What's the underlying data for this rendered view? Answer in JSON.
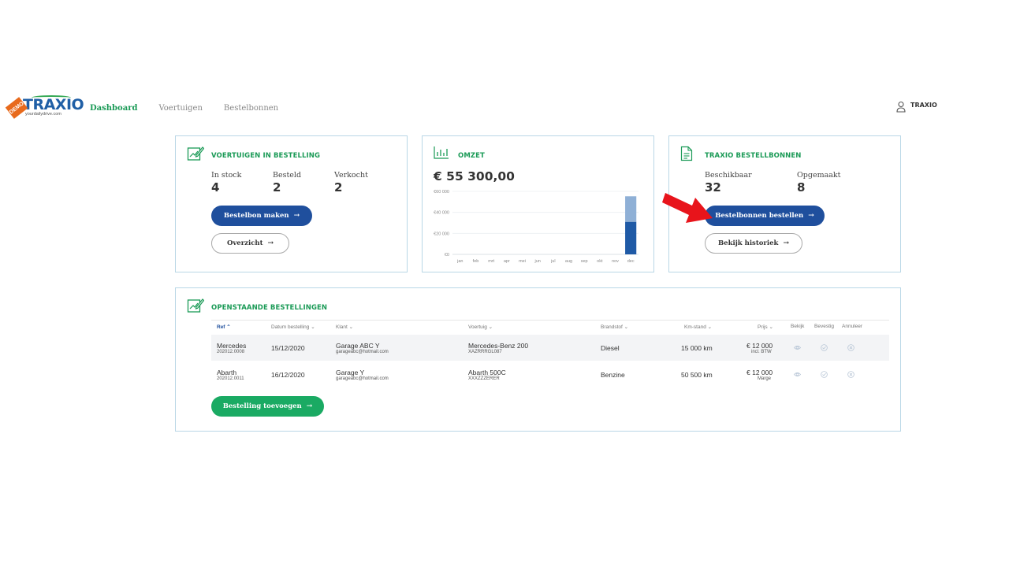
{
  "header": {
    "logo_text": "TRAXIO",
    "logo_badge": "DEMO",
    "logo_tagline": "yourdailydrive.com",
    "nav": [
      {
        "label": "Dashboard",
        "active": true
      },
      {
        "label": "Voertuigen",
        "active": false
      },
      {
        "label": "Bestelbonnen",
        "active": false
      }
    ],
    "user_name": "TRAXIO"
  },
  "card_vehicles": {
    "title": "VOERTUIGEN IN BESTELLING",
    "stats": [
      {
        "label": "In stock",
        "value": "4"
      },
      {
        "label": "Besteld",
        "value": "2"
      },
      {
        "label": "Verkocht",
        "value": "2"
      }
    ],
    "primary_button": "Bestelbon maken",
    "secondary_button": "Overzicht"
  },
  "card_omzet": {
    "title": "OMZET",
    "amount": "€ 55 300,00",
    "chart_data": {
      "type": "bar",
      "categories": [
        "jan",
        "feb",
        "mrt",
        "apr",
        "mei",
        "jun",
        "jul",
        "aug",
        "sep",
        "okt",
        "nov",
        "dec"
      ],
      "series": [
        {
          "values": [
            0,
            0,
            0,
            0,
            0,
            0,
            0,
            0,
            0,
            0,
            0,
            31000
          ]
        },
        {
          "values": [
            0,
            0,
            0,
            0,
            0,
            0,
            0,
            0,
            0,
            0,
            0,
            24300
          ]
        }
      ],
      "stacked": true,
      "ylim": [
        0,
        60000
      ],
      "yticks": [
        "€0",
        "€20 000",
        "€40 000",
        "€60 000"
      ],
      "ytick_values": [
        0,
        20000,
        40000,
        60000
      ],
      "grid": true,
      "colors": [
        "#1f5aa6",
        "#8fb0d6"
      ]
    }
  },
  "card_bestelbonnen": {
    "title": "TRAXIO BESTELLBONNEN",
    "stats": [
      {
        "label": "Beschikbaar",
        "value": "32"
      },
      {
        "label": "Opgemaakt",
        "value": "8"
      }
    ],
    "primary_button": "Bestelbonnen bestellen",
    "secondary_button": "Bekijk historiek"
  },
  "orders": {
    "title": "OPENSTAANDE BESTELLINGEN",
    "columns": [
      "Ref",
      "Datum bestelling",
      "Klant",
      "Voertuig",
      "Brandstof",
      "Km-stand",
      "Prijs",
      "Bekijk",
      "Bevestig",
      "Annuleer"
    ],
    "rows": [
      {
        "ref": "Mercedes",
        "ref_code": "202012.0008",
        "date": "15/12/2020",
        "client": "Garage ABC Y",
        "client_email": "garageabc@hotmail.com",
        "vehicle": "Mercedes-Benz 200",
        "vehicle_code": "XAZRRRGL087",
        "fuel": "Diesel",
        "km": "15 000 km",
        "price": "€ 12 000",
        "price_note": "incl. BTW"
      },
      {
        "ref": "Abarth",
        "ref_code": "202012.0011",
        "date": "16/12/2020",
        "client": "Garage Y",
        "client_email": "garageabc@hotmail.com",
        "vehicle": "Abarth 500C",
        "vehicle_code": "XXXZZZERER",
        "fuel": "Benzine",
        "km": "50 500 km",
        "price": "€ 12 000",
        "price_note": "Marge"
      }
    ],
    "add_button": "Bestelling toevoegen"
  },
  "colors": {
    "brand_green": "#1a9a56",
    "primary_blue": "#1f4f9d",
    "button_green": "#1aaa63",
    "card_border": "#b9d7e6",
    "annotation_red": "#e8141b"
  }
}
